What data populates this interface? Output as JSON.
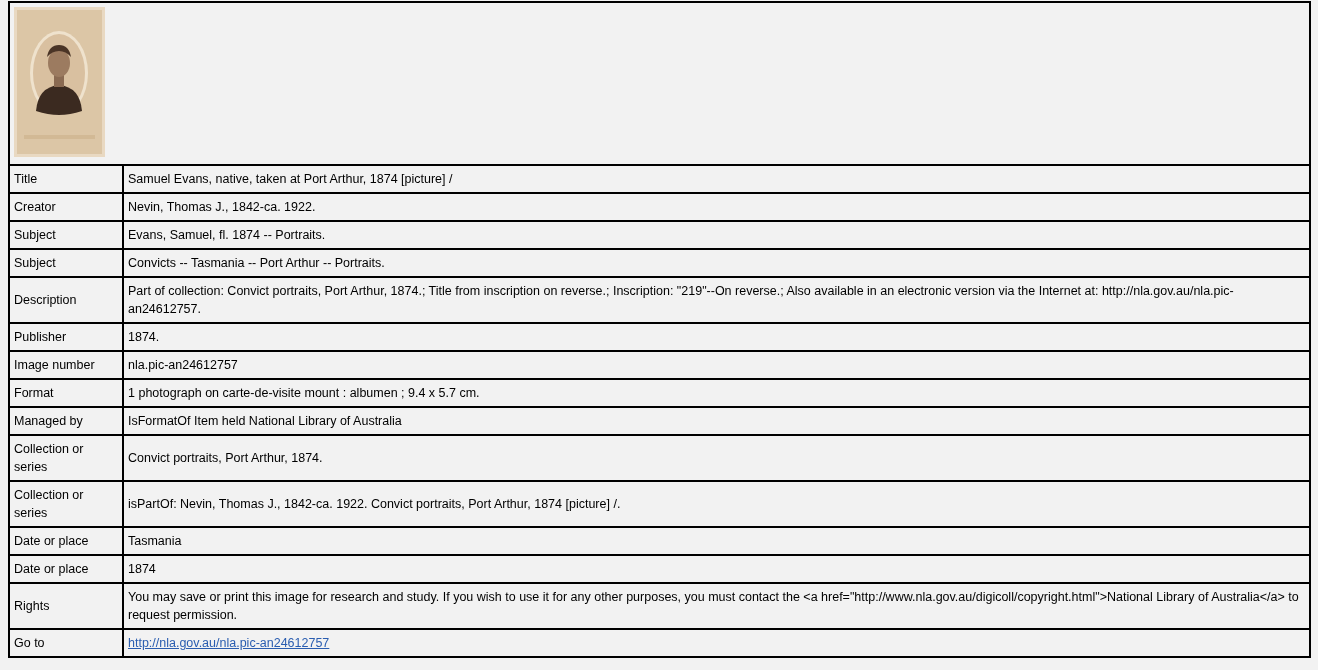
{
  "rows": [
    {
      "label": "Title",
      "value": "Samuel Evans, native, taken at Port Arthur, 1874 [picture] /",
      "kind": "text"
    },
    {
      "label": "Creator",
      "value": "Nevin, Thomas J., 1842-ca. 1922.",
      "kind": "text"
    },
    {
      "label": "Subject",
      "value": "Evans, Samuel, fl. 1874 -- Portraits.",
      "kind": "text"
    },
    {
      "label": "Subject",
      "value": "Convicts -- Tasmania -- Port Arthur -- Portraits.",
      "kind": "text"
    },
    {
      "label": "Description",
      "value": "Part of collection: Convict portraits, Port Arthur, 1874.; Title from inscription on reverse.; Inscription: \"219\"--On reverse.; Also available in an electronic version via the Internet at: http://nla.gov.au/nla.pic-an24612757.",
      "kind": "text"
    },
    {
      "label": "Publisher",
      "value": "1874.",
      "kind": "text"
    },
    {
      "label": "Image number",
      "value": "nla.pic-an24612757",
      "kind": "text"
    },
    {
      "label": "Format",
      "value": "1 photograph on carte-de-visite mount : albumen ; 9.4 x 5.7 cm.",
      "kind": "text"
    },
    {
      "label": "Managed by",
      "value": "IsFormatOf Item held National Library of Australia",
      "kind": "text"
    },
    {
      "label": "Collection or series",
      "value": "Convict portraits, Port Arthur, 1874.",
      "kind": "text"
    },
    {
      "label": "Collection or series",
      "value": "isPartOf: Nevin, Thomas J., 1842-ca. 1922. Convict portraits, Port Arthur, 1874 [picture] /.",
      "kind": "text"
    },
    {
      "label": "Date or place",
      "value": "Tasmania",
      "kind": "text"
    },
    {
      "label": "Date or place",
      "value": "1874",
      "kind": "text"
    },
    {
      "label": "Rights",
      "value": "You may save or print this image for research and study. If you wish to use it for any other purposes, you must contact the <a href=\"http://www.nla.gov.au/digicoll/copyright.html\">National Library of Australia</a> to request permission.",
      "kind": "text"
    },
    {
      "label": "Go to",
      "value": "http://nla.gov.au/nla.pic-an24612757",
      "kind": "link"
    }
  ]
}
